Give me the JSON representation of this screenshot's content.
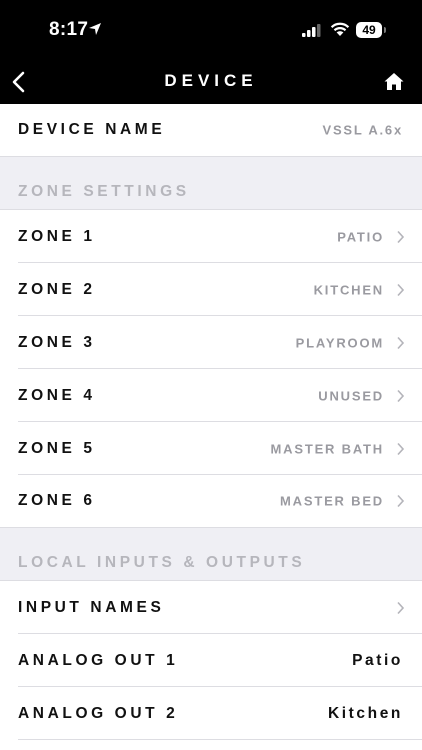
{
  "status_bar": {
    "time": "8:17",
    "battery": "49"
  },
  "nav": {
    "title": "DEVICE"
  },
  "device": {
    "label": "DEVICE NAME",
    "value": "VSSL A.6x"
  },
  "zone_settings": {
    "header": "ZONE SETTINGS",
    "zones": [
      {
        "label": "ZONE 1",
        "value": "PATIO"
      },
      {
        "label": "ZONE 2",
        "value": "KITCHEN"
      },
      {
        "label": "ZONE 3",
        "value": "PLAYROOM"
      },
      {
        "label": "ZONE 4",
        "value": "UNUSED"
      },
      {
        "label": "ZONE 5",
        "value": "MASTER BATH"
      },
      {
        "label": "ZONE 6",
        "value": "MASTER BED"
      }
    ]
  },
  "local_io": {
    "header": "LOCAL INPUTS & OUTPUTS",
    "input_names": {
      "label": "INPUT NAMES"
    },
    "analog_out_1": {
      "label": "ANALOG OUT 1",
      "value": "Patio"
    },
    "analog_out_2": {
      "label": "ANALOG OUT 2",
      "value": "Kitchen"
    }
  },
  "icons": {
    "back": "chevron-left-icon",
    "home": "home-icon",
    "row_disclosure": "chevron-right-icon"
  },
  "colors": {
    "bar_background": "#000000",
    "section_background": "#efeff4",
    "secondary_text": "#9a9aa0"
  }
}
